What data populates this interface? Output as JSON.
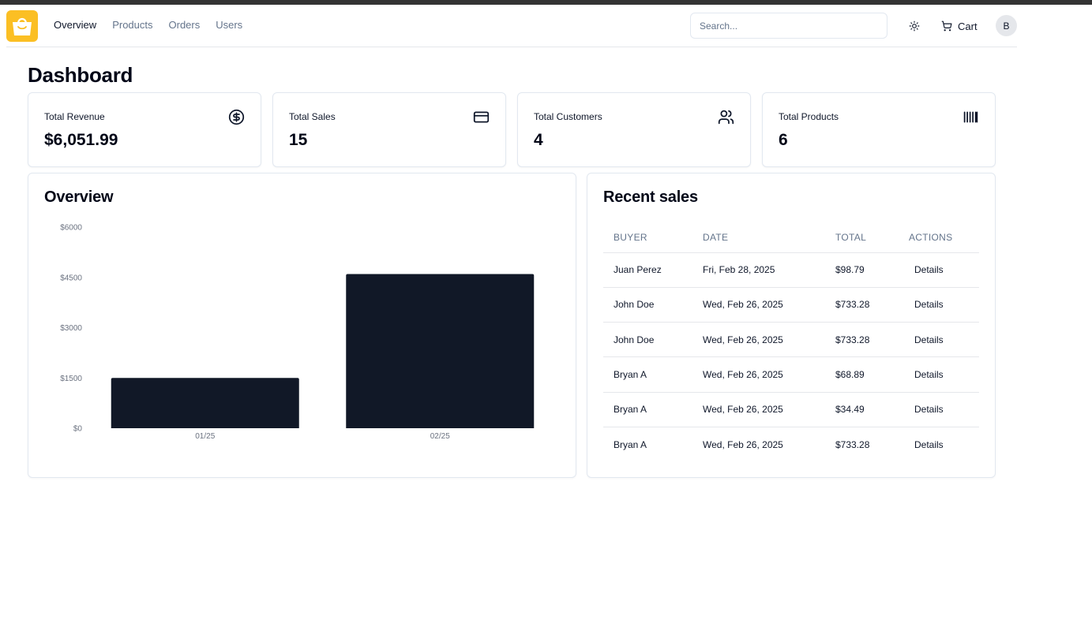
{
  "nav": {
    "links": [
      "Overview",
      "Products",
      "Orders",
      "Users"
    ],
    "active": "Overview",
    "search_placeholder": "Search...",
    "cart_label": "Cart",
    "avatar_initial": "B"
  },
  "page_title": "Dashboard",
  "stats": [
    {
      "title": "Total Revenue",
      "value": "$6,051.99",
      "icon": "dollar-circle-icon"
    },
    {
      "title": "Total Sales",
      "value": "15",
      "icon": "credit-card-icon"
    },
    {
      "title": "Total Customers",
      "value": "4",
      "icon": "users-icon"
    },
    {
      "title": "Total Products",
      "value": "6",
      "icon": "barcode-icon"
    }
  ],
  "overview": {
    "title": "Overview"
  },
  "chart_data": {
    "type": "bar",
    "categories": [
      "01/25",
      "02/25"
    ],
    "values": [
      1500,
      4600
    ],
    "ylim": [
      0,
      6000
    ],
    "yticks": [
      0,
      1500,
      3000,
      4500,
      6000
    ],
    "ytick_labels": [
      "$0",
      "$1500",
      "$3000",
      "$4500",
      "$6000"
    ],
    "title": "",
    "xlabel": "",
    "ylabel": "",
    "grid": false,
    "bar_color": "#111827"
  },
  "recent_sales": {
    "title": "Recent sales",
    "columns": [
      "BUYER",
      "DATE",
      "TOTAL",
      "ACTIONS"
    ],
    "rows": [
      {
        "buyer": "Juan Perez",
        "date": "Fri, Feb 28, 2025",
        "total": "$98.79",
        "action": "Details"
      },
      {
        "buyer": "John Doe",
        "date": "Wed, Feb 26, 2025",
        "total": "$733.28",
        "action": "Details"
      },
      {
        "buyer": "John Doe",
        "date": "Wed, Feb 26, 2025",
        "total": "$733.28",
        "action": "Details"
      },
      {
        "buyer": "Bryan A",
        "date": "Wed, Feb 26, 2025",
        "total": "$68.89",
        "action": "Details"
      },
      {
        "buyer": "Bryan A",
        "date": "Wed, Feb 26, 2025",
        "total": "$34.49",
        "action": "Details"
      },
      {
        "buyer": "Bryan A",
        "date": "Wed, Feb 26, 2025",
        "total": "$733.28",
        "action": "Details"
      }
    ]
  },
  "colors": {
    "logo_bg": "#fbbf24",
    "text_primary": "#0f172a",
    "text_muted": "#64748b",
    "border": "#e2e8f0"
  }
}
